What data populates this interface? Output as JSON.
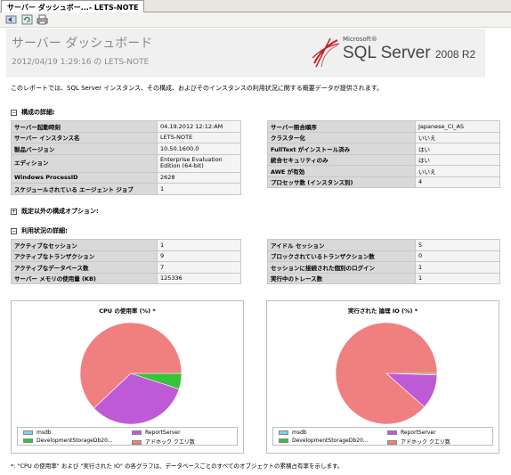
{
  "tab": {
    "title": "サーバー ダッシュボー...- LETS-NOTE"
  },
  "toolbar": {
    "icons": [
      "back-icon",
      "refresh-icon",
      "print-icon"
    ]
  },
  "header": {
    "title": "サーバー ダッシュボード",
    "subtitle": "2012/04/19 1:29:16 の LETS-NOTE",
    "logo": {
      "microsoft": "Microsoft®",
      "product": "SQL Server",
      "version": "2008 R2"
    }
  },
  "intro": "このレポートでは、SQL Server インスタンス、その構成、およびそのインスタンスの利用状況に関する概要データが提供されます。",
  "sections": {
    "config": {
      "toggle": "−",
      "label": "構成の詳細:"
    },
    "nondefault": {
      "toggle": "+",
      "label": "既定以外の構成オプション:"
    },
    "usage": {
      "toggle": "−",
      "label": "利用状況の詳細:"
    }
  },
  "config_left": [
    {
      "key": "サーバー起動時刻",
      "value": "04.19.2012 12:12:AM"
    },
    {
      "key": "サーバー インスタンス名",
      "value": "LETS-NOTE"
    },
    {
      "key": "製品バージョン",
      "value": "10.50.1600.0"
    },
    {
      "key": "エディション",
      "value": "Enterprise Evaluation Edition (64-bit)"
    },
    {
      "key": "Windows ProcessID",
      "value": "2628"
    },
    {
      "key": "スケジュールされている エージェント ジョブ",
      "value": "1"
    }
  ],
  "config_right": [
    {
      "key": "サーバー照合順序",
      "value": "Japanese_CI_AS"
    },
    {
      "key": "クラスター化",
      "value": "いいえ"
    },
    {
      "key": "FullText がインストール済み",
      "value": "はい"
    },
    {
      "key": "統合セキュリティのみ",
      "value": "はい"
    },
    {
      "key": "AWE が有効",
      "value": "いいえ"
    },
    {
      "key": "プロセッサ数 (インスタンス別)",
      "value": "4"
    }
  ],
  "usage_left": [
    {
      "key": "アクティブなセッション",
      "value": "1"
    },
    {
      "key": "アクティブなトランザクション",
      "value": "9"
    },
    {
      "key": "アクティブなデータベース数",
      "value": "7"
    },
    {
      "key": "サーバー メモリの使用量 (KB)",
      "value": "125336"
    }
  ],
  "usage_right": [
    {
      "key": "アイドル セッション",
      "value": "5"
    },
    {
      "key": "ブロックされているトランザクション数",
      "value": "0"
    },
    {
      "key": "セッションに接続された個別のログイン",
      "value": "1"
    },
    {
      "key": "実行中のトレース数",
      "value": "1"
    }
  ],
  "chart_data": [
    {
      "type": "pie",
      "title": "CPU の使用率 (%) *",
      "labels": [
        "msdb",
        "ReportServer",
        "DevelopmentStorageDb20...",
        "アドホック クエリ数"
      ],
      "values": [
        0,
        33,
        5,
        62
      ],
      "colors": [
        "#8ccfe8",
        "#bf5ad6",
        "#37c23d",
        "#f08080"
      ],
      "legend": "bottom"
    },
    {
      "type": "pie",
      "title": "実行された 論理 IO (%) *",
      "labels": [
        "msdb",
        "ReportServer",
        "DevelopmentStorageDb20...",
        "アドホック クエリ数"
      ],
      "values": [
        0,
        11,
        0.5,
        88.5
      ],
      "colors": [
        "#8ccfe8",
        "#bf5ad6",
        "#37c23d",
        "#f08080"
      ],
      "legend": "bottom"
    }
  ],
  "footnote": "*: \"CPU の使用率\" および \"実行された IO\" の各グラフは、データベースごとのすべてのオブジェクトの累積占有率を示します。"
}
